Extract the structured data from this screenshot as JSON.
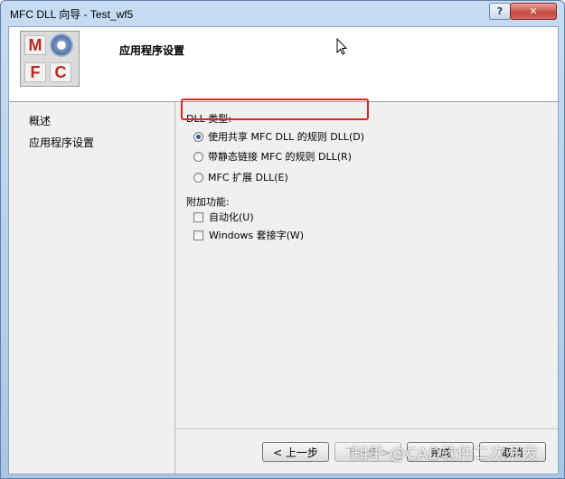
{
  "window": {
    "title": "MFC DLL 向导 - Test_wf5",
    "help_label": "?",
    "close_label": "✕"
  },
  "header": {
    "title": "应用程序设置",
    "logo_letters": [
      "M",
      "F",
      "C"
    ]
  },
  "nav": {
    "items": [
      {
        "label": "概述"
      },
      {
        "label": "应用程序设置"
      }
    ]
  },
  "settings": {
    "dll_type_label": "DLL 类型:",
    "dll_options": [
      {
        "label": "使用共享 MFC DLL 的规则 DLL(D)",
        "selected": true
      },
      {
        "label": "带静态链接 MFC 的规则 DLL(R)",
        "selected": false
      },
      {
        "label": "MFC 扩展 DLL(E)",
        "selected": false
      }
    ],
    "features_label": "附加功能:",
    "features": [
      {
        "label": "自动化(U)",
        "checked": false
      },
      {
        "label": "Windows 套接字(W)",
        "checked": false
      }
    ]
  },
  "buttons": {
    "prev": "< 上一步",
    "next": "下一步 >",
    "finish": "完成",
    "cancel": "取消"
  },
  "watermark": "知乎 @CAD软件二次开发",
  "colors": {
    "highlight_border": "#e0261f",
    "title_gradient_top": "#c7dcf2"
  }
}
